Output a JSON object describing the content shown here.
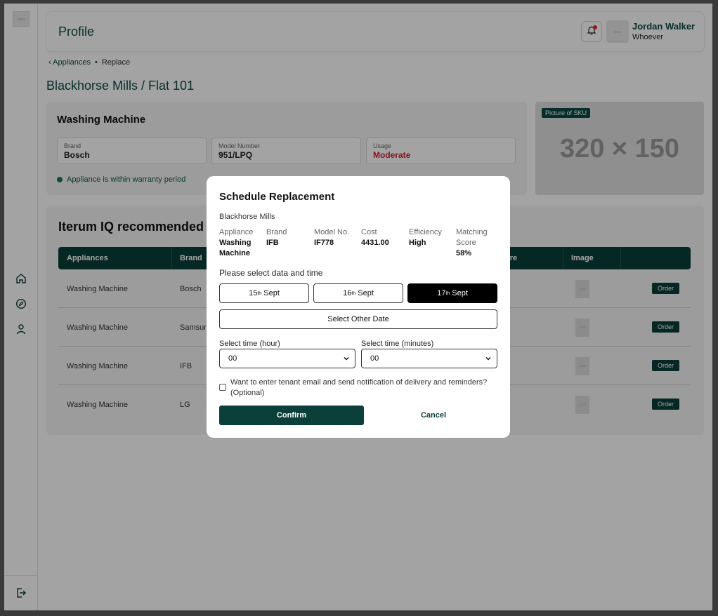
{
  "header": {
    "title": "Profile",
    "user_name": "Jordan Walker",
    "user_role": "Whoever"
  },
  "breadcrumb": {
    "parent": "Appliances",
    "current": "Replace"
  },
  "page_title": "Blackhorse Mills / Flat 101",
  "appliance_card": {
    "title": "Washing Machine",
    "fields": [
      {
        "label": "Brand",
        "value": "Bosch"
      },
      {
        "label": "Model Number",
        "value": "951/LPQ"
      },
      {
        "label": "Usage",
        "value": "Moderate"
      }
    ],
    "warranty_text": "Appliance is within warranty period"
  },
  "sku": {
    "badge": "Picture of SKU",
    "placeholder": "320 × 150"
  },
  "recommendations": {
    "title": "Iterum IQ recommended re",
    "columns": [
      "Appliances",
      "Brand",
      "ore",
      "Image"
    ],
    "rows": [
      {
        "appliance": "Washing Machine",
        "brand": "Bosch",
        "order": "Order"
      },
      {
        "appliance": "Washing Machine",
        "brand": "Samsun",
        "order": "Order"
      },
      {
        "appliance": "Washing Machine",
        "brand": "IFB",
        "order": "Order"
      },
      {
        "appliance": "Washing Machine",
        "brand": "LG",
        "order": "Order"
      }
    ]
  },
  "modal": {
    "title": "Schedule Replacement",
    "location": "Blackhorse Mills",
    "details": [
      {
        "label": "Appliance",
        "value": "Washing Machine"
      },
      {
        "label": "Brand",
        "value": "IFB"
      },
      {
        "label": "Model No.",
        "value": "IF778"
      },
      {
        "label": "Cost",
        "value": "4431.00"
      },
      {
        "label": "Efficiency",
        "value": "High"
      },
      {
        "label": "Matching Score",
        "value": "58%"
      }
    ],
    "prompt": "Please select data and time",
    "dates": [
      {
        "day": "15",
        "suffix": "th",
        "month": "Sept"
      },
      {
        "day": "16",
        "suffix": "th",
        "month": "Sept"
      },
      {
        "day": "17",
        "suffix": "th",
        "month": "Sept",
        "selected": true
      }
    ],
    "other_date_label": "Select Other Date",
    "hour_label": "Select time (hour)",
    "hour_value": "00",
    "minute_label": "Select time (minutes)",
    "minute_value": "00",
    "checkbox_text": "Want to enter tenant email and send notification of delivery and reminders? (Optional)",
    "checkbox_checked": false,
    "confirm_label": "Confirm",
    "cancel_label": "Cancel"
  },
  "colors": {
    "brand_dark": "#0a3f3a",
    "accent_red": "#d3202e",
    "warranty_green": "#1a7a52"
  }
}
